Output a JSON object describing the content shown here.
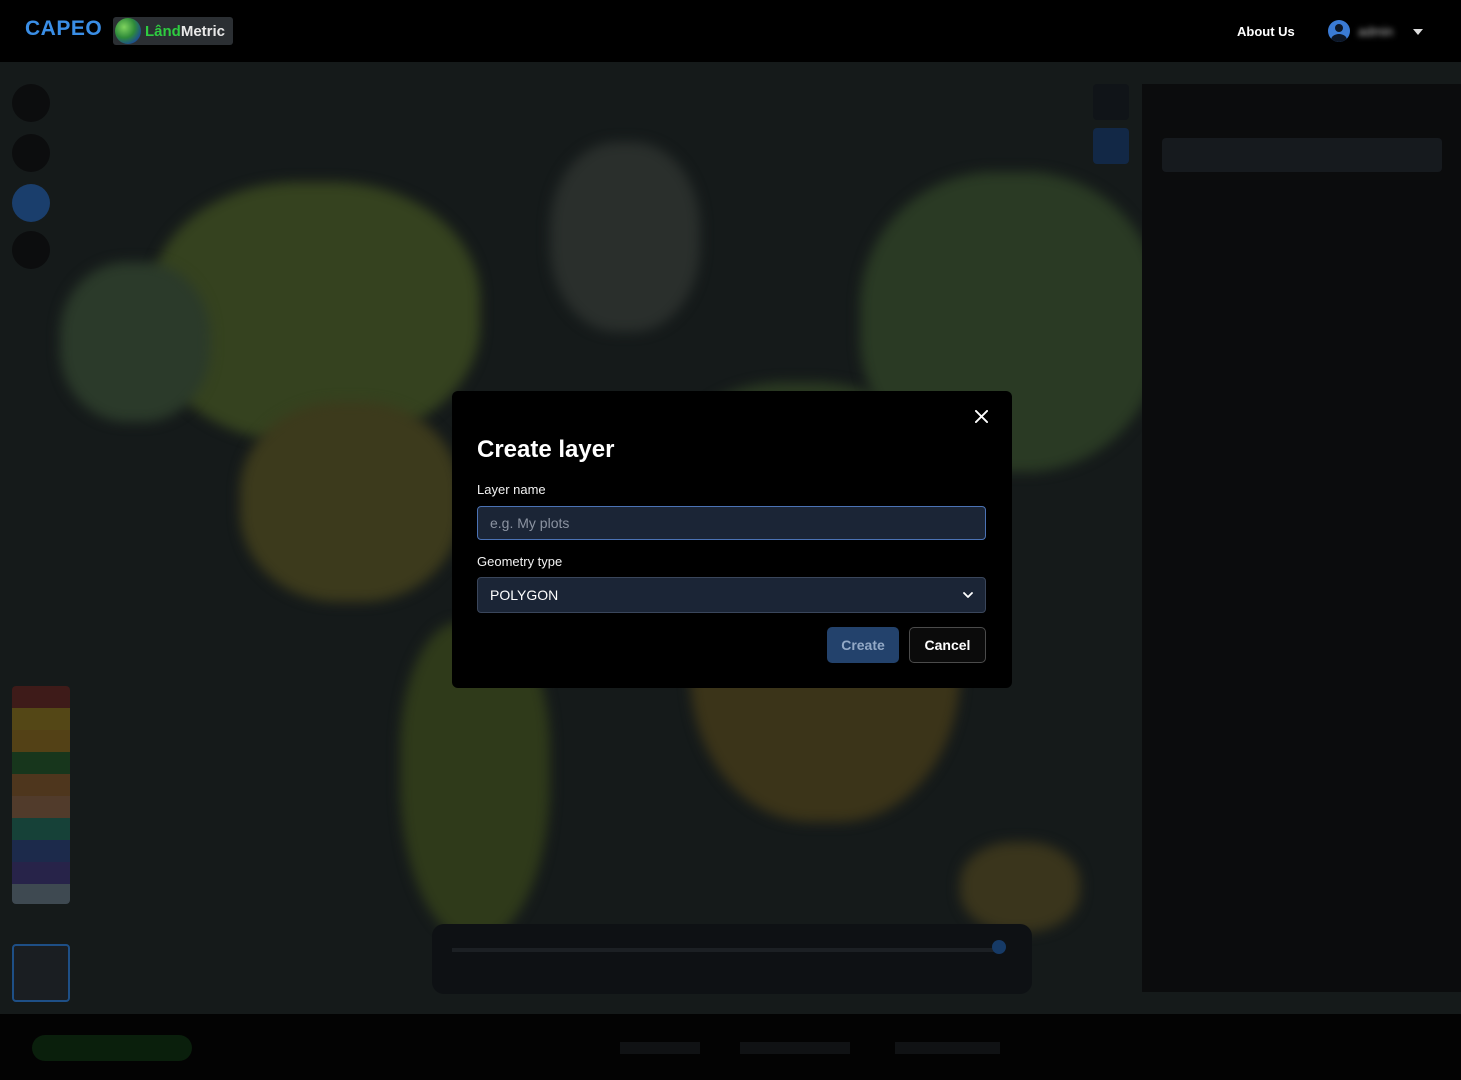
{
  "header": {
    "brand": "CAPEO",
    "logo_word_1": "Lând",
    "logo_word_2": "Metric",
    "about_label": "About Us",
    "user_name": "admin"
  },
  "modal": {
    "title": "Create layer",
    "name_label": "Layer name",
    "name_placeholder": "e.g. My plots",
    "name_value": "",
    "geometry_label": "Geometry type",
    "geometry_value": "POLYGON",
    "create_label": "Create",
    "cancel_label": "Cancel"
  },
  "colors": {
    "brand": "#3a8ee6",
    "logo_green": "#2ecc40",
    "input_bg": "#1b2536",
    "input_border_focus": "#4b72b4",
    "create_bg_disabled": "#23426c"
  },
  "icons": {
    "close": "close-icon",
    "user": "user-icon",
    "caret": "chevron-down-icon",
    "select": "chevron-down-icon"
  }
}
